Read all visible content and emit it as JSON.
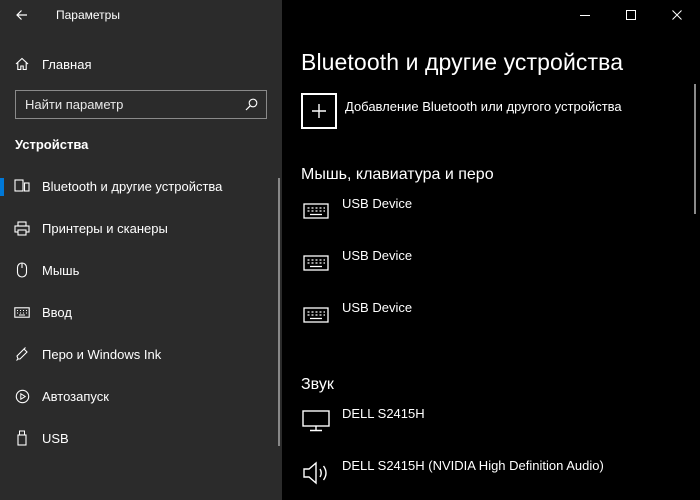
{
  "window": {
    "title": "Параметры"
  },
  "sidebar": {
    "home_label": "Главная",
    "search_placeholder": "Найти параметр",
    "section_title": "Устройства",
    "items": [
      {
        "label": "Bluetooth и другие устройства",
        "icon": "bluetooth-devices-icon",
        "selected": true
      },
      {
        "label": "Принтеры и сканеры",
        "icon": "printer-icon"
      },
      {
        "label": "Мышь",
        "icon": "mouse-icon"
      },
      {
        "label": "Ввод",
        "icon": "keyboard-icon"
      },
      {
        "label": "Перо и Windows Ink",
        "icon": "pen-icon"
      },
      {
        "label": "Автозапуск",
        "icon": "autoplay-icon"
      },
      {
        "label": "USB",
        "icon": "usb-icon"
      }
    ]
  },
  "main": {
    "title": "Bluetooth и другие устройства",
    "add_device_label": "Добавление Bluetooth или другого устройства",
    "groups": [
      {
        "title": "Мышь, клавиатура и перо",
        "devices": [
          {
            "name": "USB Device",
            "icon": "keyboard-icon"
          },
          {
            "name": "USB Device",
            "icon": "keyboard-icon"
          },
          {
            "name": "USB Device",
            "icon": "keyboard-icon"
          }
        ]
      },
      {
        "title": "Звук",
        "devices": [
          {
            "name": "DELL S2415H",
            "icon": "monitor-icon"
          },
          {
            "name": "DELL S2415H (NVIDIA High Definition Audio)",
            "icon": "speaker-icon"
          }
        ]
      }
    ]
  },
  "colors": {
    "sidebar_bg": "#2b2b2b",
    "content_bg": "#000000",
    "accent": "#0078d7"
  }
}
